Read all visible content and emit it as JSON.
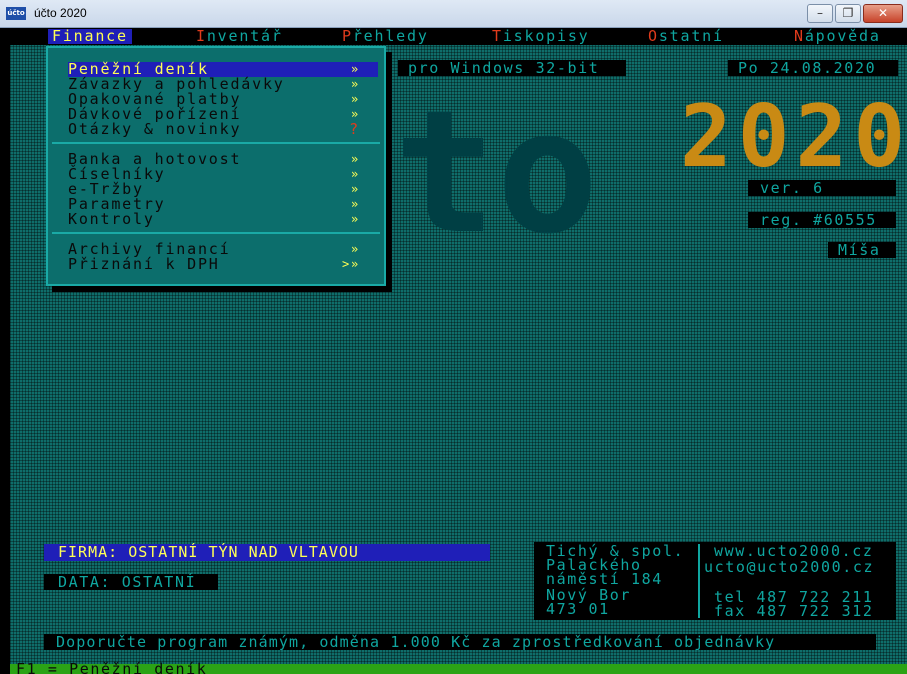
{
  "window": {
    "title": "účto 2020",
    "icon_label": "účto"
  },
  "menubar": [
    {
      "label": "Finance",
      "active": true
    },
    {
      "label": "Inventář"
    },
    {
      "label": "Přehledy"
    },
    {
      "label": "Tiskopisy"
    },
    {
      "label": "Ostatní"
    },
    {
      "label": "Nápověda"
    }
  ],
  "dropdown": {
    "groups": [
      [
        "Peněžní deník",
        "Závazky a pohledávky",
        "Opakované platby",
        "Dávkové pořízení",
        "Otázky & novinky"
      ],
      [
        "Banka a hotovost",
        "Číselníky",
        "e-Tržby",
        "Parametry",
        "Kontroly"
      ],
      [
        "Archivy financí",
        "Přiznání k DPH"
      ]
    ],
    "selected": "Peněžní deník"
  },
  "info": {
    "platform": "pro Windows 32-bit",
    "date": "Po 24.08.2020",
    "logo_year": "2020",
    "logo_letters": "to",
    "version": "ver. 6",
    "registration": "reg. #60555",
    "user": "Míša"
  },
  "firma": "FIRMA: OSTATNÍ TÝN NAD VLTAVOU",
  "data": "DATA: OSTATNÍ",
  "contact": {
    "company": [
      "Tichý & spol.",
      "Palackého",
      "náměstí 184",
      "Nový Bor",
      "473 01"
    ],
    "web": "www.ucto2000.cz",
    "email": "ucto@ucto2000.cz",
    "tel": "tel 487 722 211",
    "fax": "fax 487 722 312"
  },
  "promo": "Doporučte program známým, odměna 1.000 Kč za zprostředkování objednávky",
  "status": "F1 = Peněžní deník"
}
